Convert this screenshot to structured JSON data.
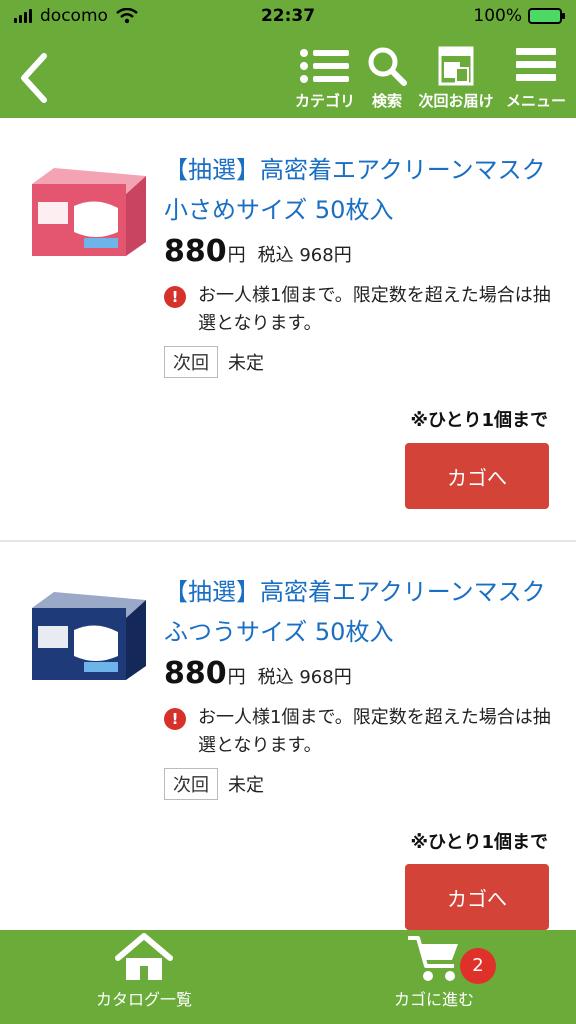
{
  "status_bar": {
    "carrier": "docomo",
    "time": "22:37",
    "battery": "100%"
  },
  "header": {
    "nav": [
      {
        "label": "カテゴリ",
        "icon": "list-icon"
      },
      {
        "label": "検索",
        "icon": "search-icon"
      },
      {
        "label": "次回お届け",
        "icon": "delivery-doc-icon"
      },
      {
        "label": "メニュー",
        "icon": "hamburger-menu-icon"
      }
    ]
  },
  "products": [
    {
      "title": "【抽選】高密着エアクリーンマスク 小さめサイズ 50枚入",
      "price": "880",
      "yen": "円",
      "tax_label": "税込 968円",
      "notice": "お一人様1個まで。限定数を超えた場合は抽選となります。",
      "next_tag": "次回",
      "next_value": "未定",
      "limit": "※ひとり1個まで",
      "cart_label": "カゴへ",
      "box_color": "#e4566f"
    },
    {
      "title": "【抽選】高密着エアクリーンマスク ふつうサイズ 50枚入",
      "price": "880",
      "yen": "円",
      "tax_label": "税込 968円",
      "notice": "お一人様1個まで。限定数を超えた場合は抽選となります。",
      "next_tag": "次回",
      "next_value": "未定",
      "limit": "※ひとり1個まで",
      "cart_label": "カゴへ",
      "box_color": "#1f3a78"
    }
  ],
  "bottom_bar": {
    "catalog_label": "カタログ一覧",
    "cart_label": "カゴに進む",
    "cart_count": "2"
  },
  "colors": {
    "brand_green": "#6aab3a",
    "link_blue": "#1a6fc4",
    "cart_red": "#d34337",
    "badge_red": "#e0302a"
  }
}
